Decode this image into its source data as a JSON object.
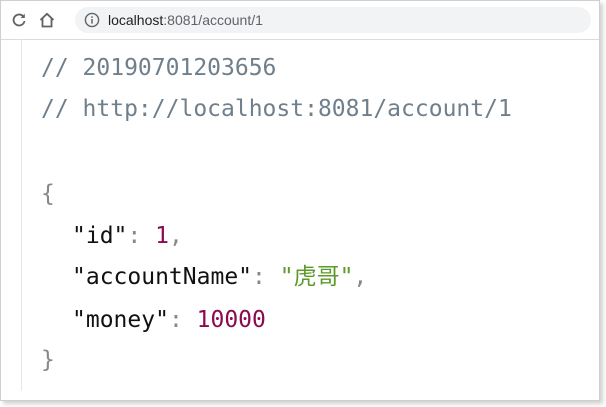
{
  "browser": {
    "url_host": "localhost",
    "url_path": ":8081/account/1"
  },
  "page": {
    "comment_timestamp": "// 20190701203656",
    "comment_url": "// http://localhost:8081/account/1",
    "open_brace": "{",
    "close_brace": "}",
    "fields": [
      {
        "key": "\"id\"",
        "sep": ": ",
        "value": "1",
        "trail": ","
      },
      {
        "key": "\"accountName\"",
        "sep": ": ",
        "value": "\"虎哥\"",
        "trail": ","
      },
      {
        "key": "\"money\"",
        "sep": ": ",
        "value": "10000",
        "trail": ""
      }
    ]
  },
  "colors": {
    "comment": "#6f7f8c",
    "number": "#8b0a50",
    "string": "#5c9a2a",
    "punctuation": "#888888"
  },
  "icons": {
    "reload": "reload-icon",
    "home": "home-icon",
    "info": "info-icon"
  }
}
